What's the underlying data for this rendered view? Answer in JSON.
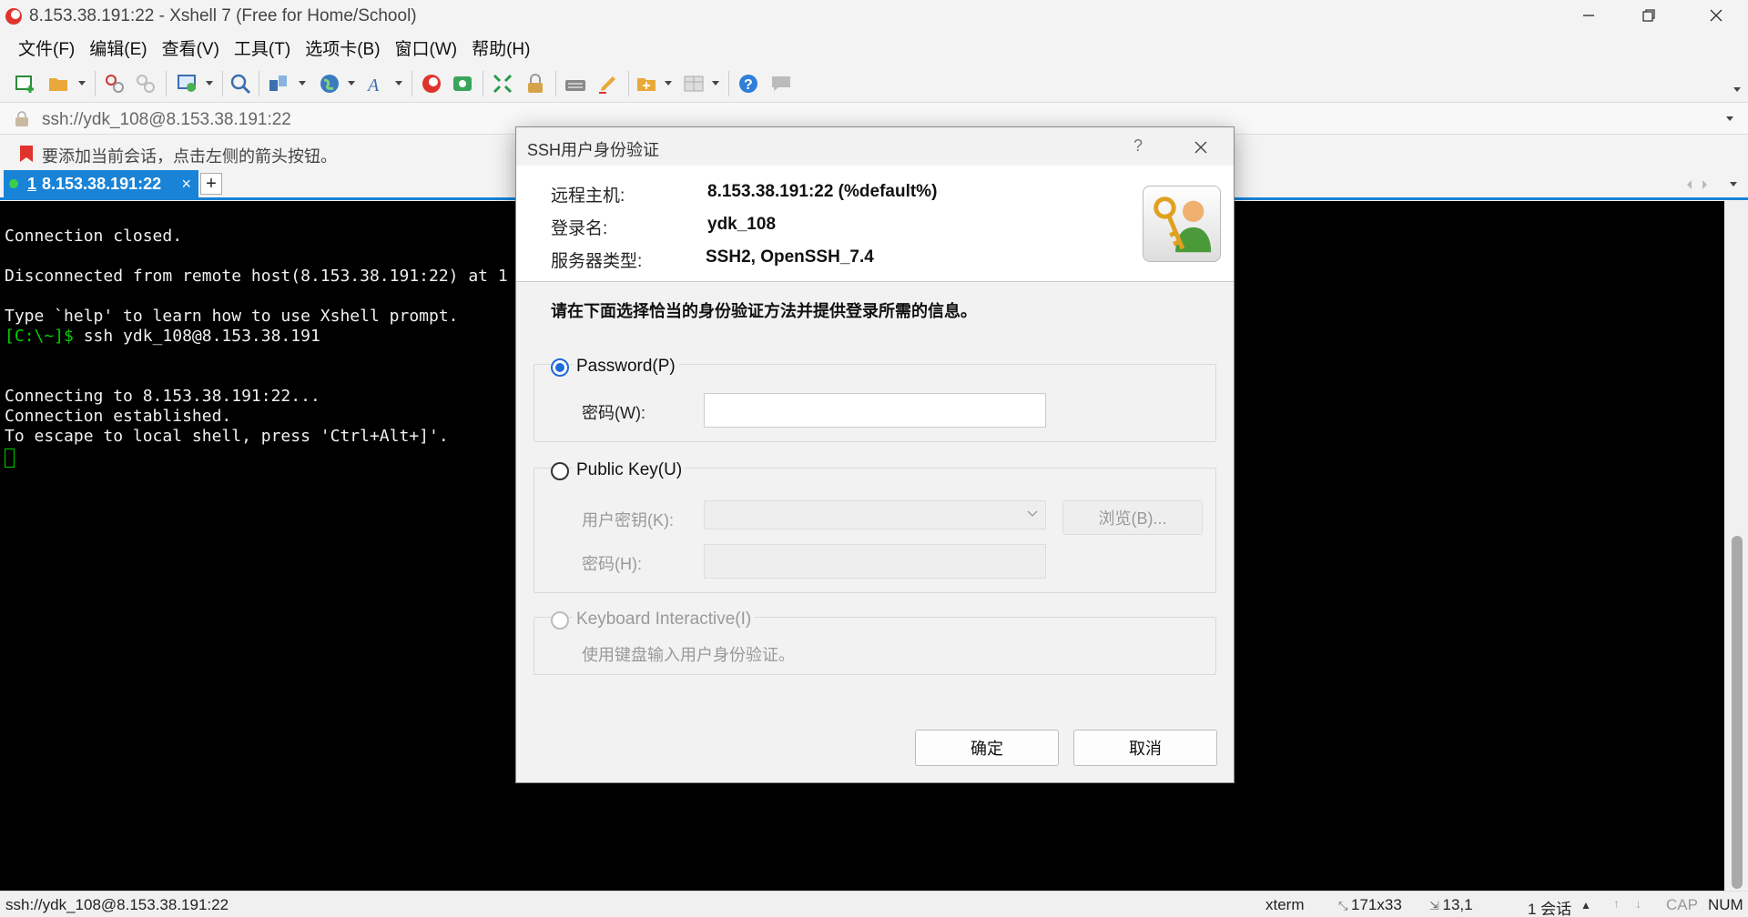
{
  "window": {
    "title": "8.153.38.191:22 - Xshell 7 (Free for Home/School)"
  },
  "menu": [
    "文件(F)",
    "编辑(E)",
    "查看(V)",
    "工具(T)",
    "选项卡(B)",
    "窗口(W)",
    "帮助(H)"
  ],
  "address_bar": {
    "value": "ssh://ydk_108@8.153.38.191:22"
  },
  "hint_bar": {
    "text": "要添加当前会话，点击左侧的箭头按钮。"
  },
  "tabs": [
    {
      "number": "1",
      "label": "8.153.38.191:22",
      "close": "×"
    }
  ],
  "new_tab_label": "+",
  "terminal": {
    "lines": [
      {
        "text": "Connection closed."
      },
      {
        "text": ""
      },
      {
        "text": "Disconnected from remote host(8.153.38.191:22) at 1"
      },
      {
        "text": ""
      },
      {
        "text": "Type `help' to learn how to use Xshell prompt."
      },
      {
        "prompt": "[C:\\~]$",
        "text": " ssh ydk_108@8.153.38.191"
      },
      {
        "text": ""
      },
      {
        "text": ""
      },
      {
        "text": "Connecting to 8.153.38.191:22..."
      },
      {
        "text": "Connection established."
      },
      {
        "text": "To escape to local shell, press 'Ctrl+Alt+]'."
      }
    ]
  },
  "status_bar": {
    "session": "ssh://ydk_108@8.153.38.191:22",
    "term_type": "xterm",
    "size": "171x33",
    "cursor_pos": "13,1",
    "sessions": "1 会话",
    "cap": "CAP",
    "num": "NUM"
  },
  "dialog": {
    "title": "SSH用户身份验证",
    "help": "?",
    "remote_host_label": "远程主机:",
    "remote_host_value": "8.153.38.191:22 (%default%)",
    "login_label": "登录名:",
    "login_value": "ydk_108",
    "server_type_label": "服务器类型:",
    "server_type_value": "SSH2, OpenSSH_7.4",
    "instruction": "请在下面选择恰当的身份验证方法并提供登录所需的信息。",
    "password_option": "Password(P)",
    "password_field_label": "密码(W):",
    "password_value": "",
    "pubkey_option": "Public Key(U)",
    "user_key_label": "用户密钥(K):",
    "user_key_value": "",
    "browse_button": "浏览(B)...",
    "passphrase_label": "密码(H):",
    "keyboard_option": "Keyboard Interactive(I)",
    "keyboard_desc": "使用键盘输入用户身份验证。",
    "ok_button": "确定",
    "cancel_button": "取消",
    "selected_method": "Password"
  },
  "colors": {
    "tab_active": "#1883d7",
    "terminal_bg": "#000000",
    "prompt": "#00d000",
    "radio_selected": "#1e6ad6"
  },
  "icons": [
    "new-session-icon",
    "open-folder-icon",
    "reconnect-icon",
    "disconnect-icon",
    "properties-icon",
    "find-icon",
    "transfer-icon",
    "globe-icon",
    "font-icon",
    "xftp-icon",
    "xagent-icon",
    "fullscreen-icon",
    "lock-icon",
    "keyboard-icon",
    "highlight-icon",
    "compose-icon",
    "layout-icon",
    "help-icon",
    "chat-icon"
  ]
}
